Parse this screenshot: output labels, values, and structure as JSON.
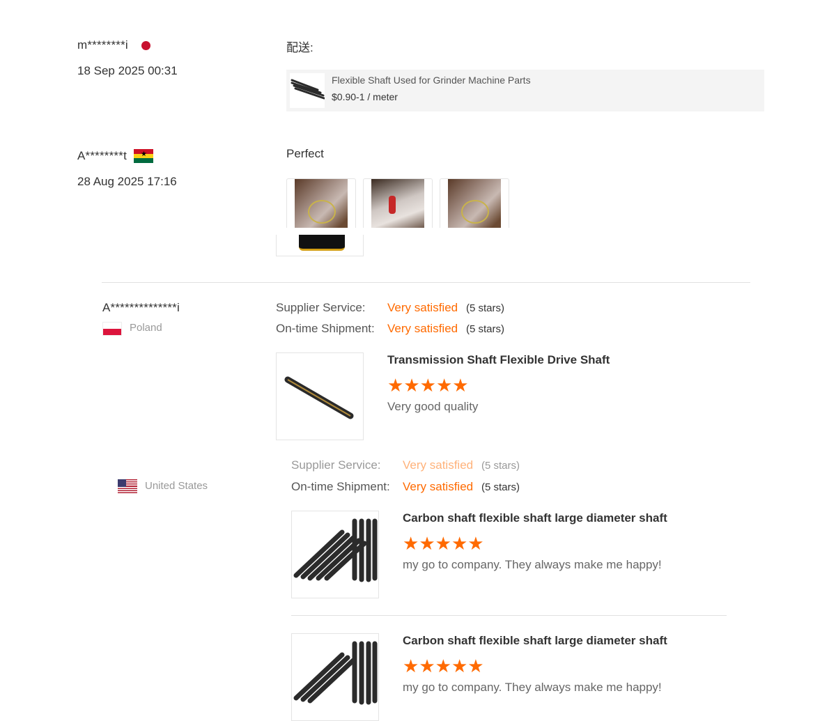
{
  "reviews_top": [
    {
      "user": "m********i",
      "date": "18 Sep 2025 00:31",
      "comment": "配送:",
      "product": {
        "name": "Flexible Shaft Used for Grinder Machine Parts",
        "price": "$0.90-1 / meter"
      }
    },
    {
      "user": "A********t",
      "date": "28 Aug 2025 17:16",
      "comment": "Perfect"
    }
  ],
  "review_poland": {
    "user": "A**************i",
    "country": "Poland",
    "supplier_label": "Supplier Service:",
    "supplier_value": "Very satisfied",
    "supplier_stars": "(5 stars)",
    "shipment_label": "On-time Shipment:",
    "shipment_value": "Very satisfied",
    "shipment_stars": "(5 stars)",
    "product_title": "Transmission Shaft Flexible Drive Shaft",
    "rating": 5,
    "text": "Very good quality"
  },
  "review_us": {
    "country": "United States",
    "supplier_label": "Supplier Service:",
    "supplier_value": "Very satisfied",
    "supplier_stars": "(5 stars)",
    "shipment_label": "On-time Shipment:",
    "shipment_value": "Very satisfied",
    "shipment_stars": "(5 stars)",
    "items": [
      {
        "title": "Carbon shaft flexible shaft large diameter shaft",
        "rating": 5,
        "text": "my go to company. They always make me happy!"
      },
      {
        "title": "Carbon shaft flexible shaft large diameter shaft",
        "rating": 5,
        "text": "my go to company. They always make me happy!"
      }
    ]
  },
  "colors": {
    "accent": "#ff6a00",
    "flag_japan": "#c8102e"
  }
}
